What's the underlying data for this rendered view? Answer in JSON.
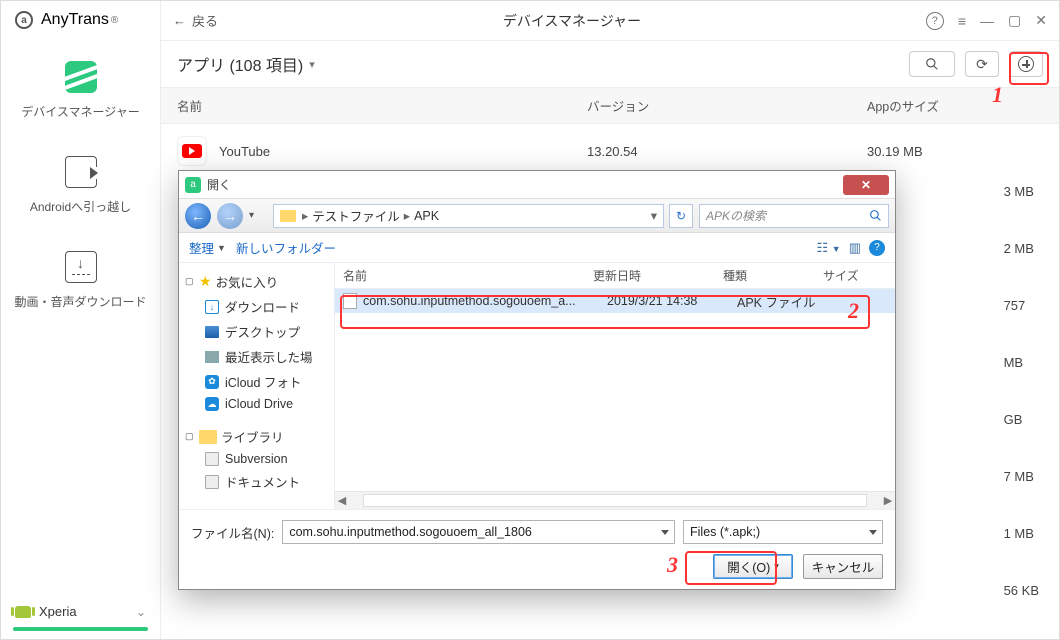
{
  "brand": {
    "name": "AnyTrans",
    "reg": "®"
  },
  "sidebar": {
    "items": [
      {
        "label": "デバイスマネージャー"
      },
      {
        "label": "Androidへ引っ越し"
      },
      {
        "label": "動画・音声ダウンロード"
      }
    ],
    "device": "Xperia"
  },
  "header": {
    "back": "戻る",
    "title": "デバイスマネージャー"
  },
  "subheader": {
    "title": "アプリ (108 項目)"
  },
  "columns": {
    "name": "名前",
    "version": "バージョン",
    "size": "Appのサイズ"
  },
  "rows": [
    {
      "name": "YouTube",
      "version": "13.20.54",
      "size": "30.19 MB"
    }
  ],
  "ghost_sizes": [
    "3 MB",
    "2 MB",
    "757",
    "MB",
    "GB",
    "7 MB",
    "1 MB",
    "56 KB"
  ],
  "dialog": {
    "title": "開く",
    "breadcrumb": {
      "a": "テストファイル",
      "b": "APK"
    },
    "search_ph": "APKの検索",
    "toolbar": {
      "organize": "整理",
      "newfolder": "新しいフォルダー"
    },
    "tree": {
      "fav": "お気に入り",
      "fav_items": [
        "ダウンロード",
        "デスクトップ",
        "最近表示した場",
        "iCloud フォト",
        "iCloud Drive"
      ],
      "lib": "ライブラリ",
      "lib_items": [
        "Subversion",
        "ドキュメント"
      ]
    },
    "list_columns": {
      "name": "名前",
      "date": "更新日時",
      "type": "種類",
      "size": "サイズ"
    },
    "file": {
      "name": "com.sohu.inputmethod.sogouoem_a...",
      "date": "2019/3/21 14:38",
      "type": "APK ファイル"
    },
    "footer": {
      "filename_lbl": "ファイル名(N):",
      "filename_val": "com.sohu.inputmethod.sogouoem_all_1806",
      "filter": "Files (*.apk;)",
      "open": "開く(O)",
      "cancel": "キャンセル"
    }
  }
}
